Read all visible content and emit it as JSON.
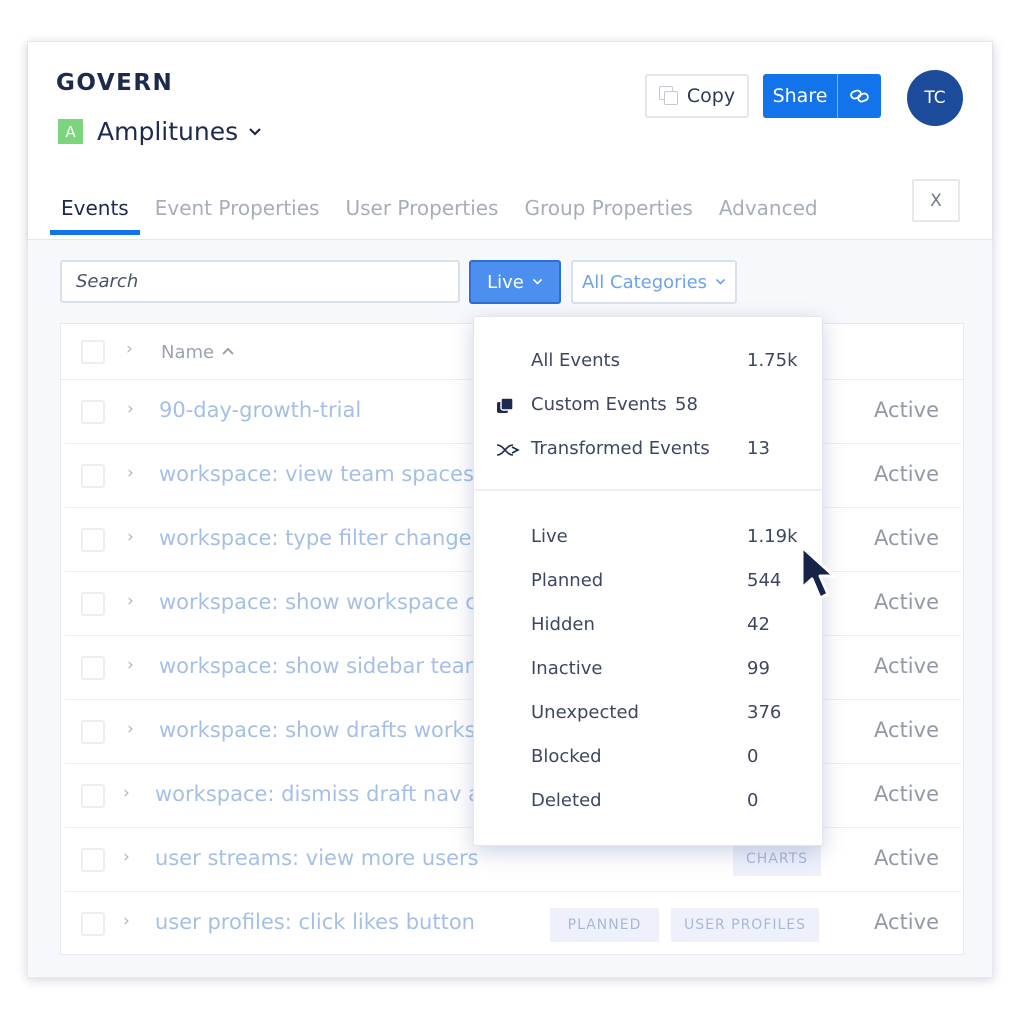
{
  "header": {
    "section_title": "GOVERN",
    "project_badge": "A",
    "project_name": "Amplitunes",
    "project_chevron": "⌄",
    "copy_label": "Copy",
    "share_label": "Share",
    "avatar_initials": "TC",
    "close_label": "X"
  },
  "tabs": [
    {
      "label": "Events",
      "active": true
    },
    {
      "label": "Event Properties",
      "active": false
    },
    {
      "label": "User Properties",
      "active": false
    },
    {
      "label": "Group Properties",
      "active": false
    },
    {
      "label": "Advanced",
      "active": false
    }
  ],
  "toolbar": {
    "search_placeholder": "Search",
    "live_label": "Live",
    "categories_label": "All Categories"
  },
  "table": {
    "name_header": "Name",
    "sort_arrow": "^",
    "rows": [
      {
        "name": "90-day-growth-trial",
        "status": "Active",
        "tags": []
      },
      {
        "name": "workspace: view team spaces ba",
        "status": "Active",
        "tags": []
      },
      {
        "name": "workspace: type filter changed",
        "status": "Active",
        "tags": []
      },
      {
        "name": "workspace: show workspace cu",
        "status": "Active",
        "tags": []
      },
      {
        "name": "workspace: show sidebar team s",
        "status": "Active",
        "tags": []
      },
      {
        "name": "workspace: show drafts workspa",
        "status": "Active",
        "tags": []
      },
      {
        "name": "workspace: dismiss draft nav aw",
        "status": "Active",
        "tags": []
      },
      {
        "name": "user streams: view more users",
        "status": "Active",
        "tags": [
          "CHARTS"
        ]
      },
      {
        "name": "user profiles: click likes button",
        "status": "Active",
        "tags": [
          "PLANNED",
          "USER PROFILES"
        ]
      }
    ]
  },
  "dropdown": {
    "top_items": [
      {
        "label": "All Events",
        "count": "1.75k",
        "icon": "none"
      },
      {
        "label": "Custom Events",
        "count": "58",
        "icon": "custom-events-icon"
      },
      {
        "label": "Transformed Events",
        "count": "13",
        "icon": "transform-icon"
      }
    ],
    "status_items": [
      {
        "label": "Live",
        "count": "1.19k"
      },
      {
        "label": "Planned",
        "count": "544"
      },
      {
        "label": "Hidden",
        "count": "42"
      },
      {
        "label": "Inactive",
        "count": "99"
      },
      {
        "label": "Unexpected",
        "count": "376"
      },
      {
        "label": "Blocked",
        "count": "0"
      },
      {
        "label": "Deleted",
        "count": "0"
      }
    ]
  },
  "colors": {
    "primary": "#1273eb",
    "navy": "#1d2a4d",
    "avatar": "#1d4b9c",
    "badge_green": "#7bd57c"
  }
}
